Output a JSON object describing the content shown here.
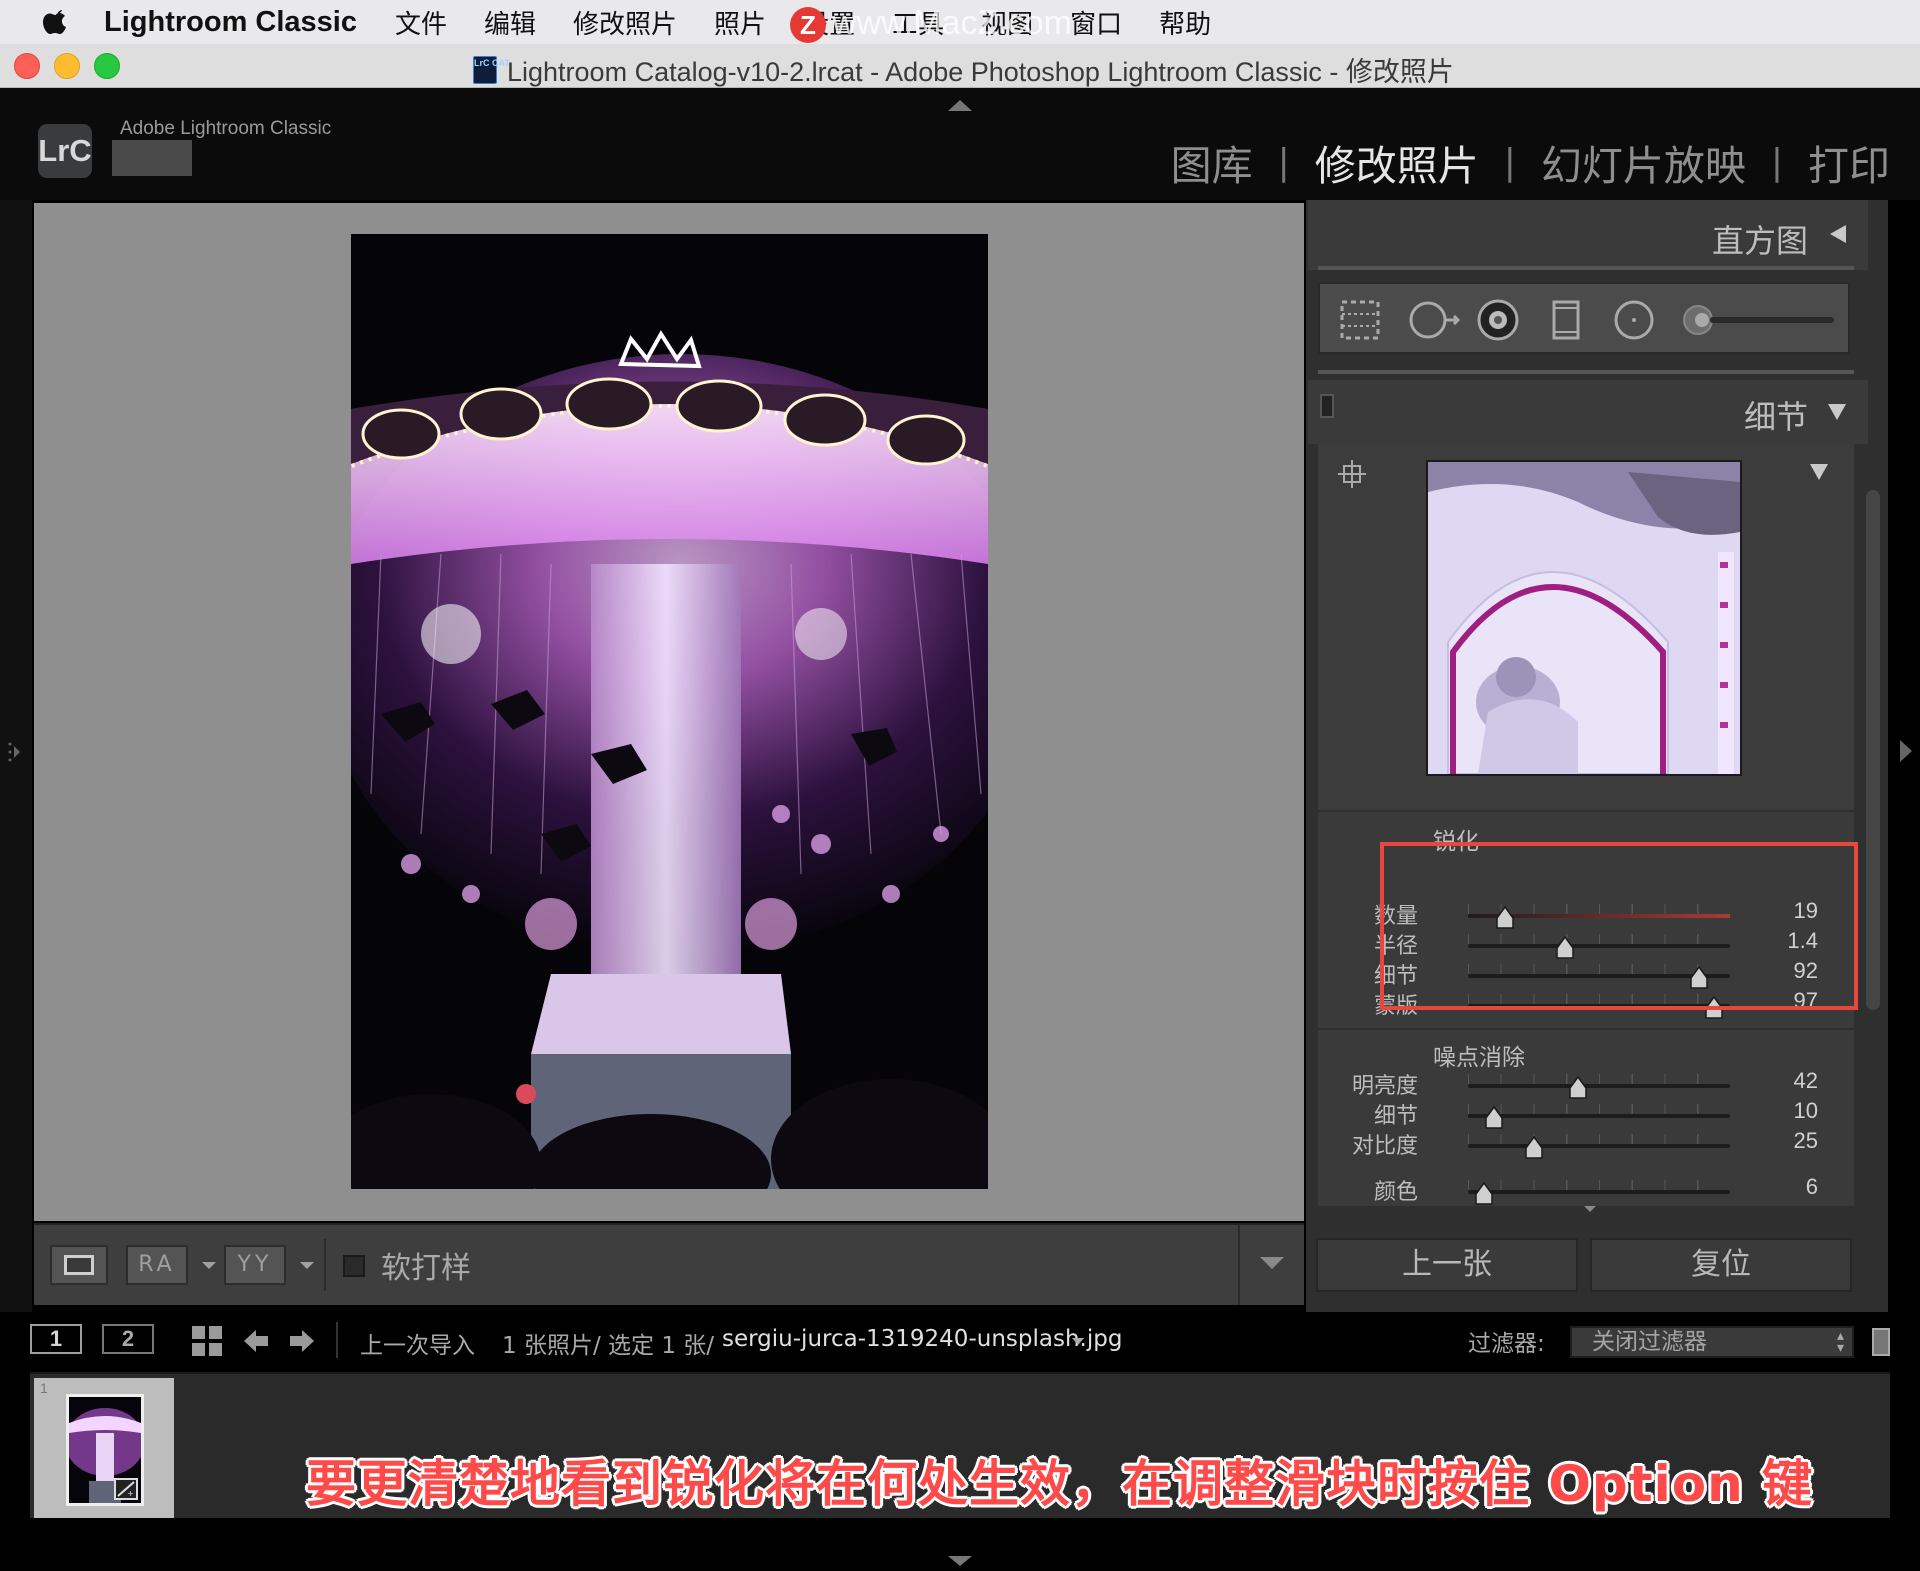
{
  "menubar": {
    "app_name": "Lightroom Classic",
    "items": [
      "文件",
      "编辑",
      "修改照片",
      "照片",
      "设置",
      "工具",
      "视图",
      "窗口",
      "帮助"
    ]
  },
  "watermark": {
    "logo_letter": "Z",
    "text": "www.MacZ.com"
  },
  "window": {
    "doc_icon_text": "LrC CAT",
    "title": "Lightroom Catalog-v10-2.lrcat - Adobe Photoshop Lightroom Classic - 修改照片"
  },
  "topbar": {
    "logo": "LrC",
    "brand": "Adobe Lightroom Classic",
    "modules": [
      {
        "label": "图库",
        "active": false
      },
      {
        "label": "修改照片",
        "active": true
      },
      {
        "label": "幻灯片放映",
        "active": false
      },
      {
        "label": "打印",
        "active": false
      }
    ],
    "separator": "|"
  },
  "toolbar": {
    "view_mode_1": "RA",
    "view_mode_2": "YY",
    "soft_proof_label": "软打样",
    "soft_proof_checked": false
  },
  "right_panel": {
    "histogram_title": "直方图",
    "detail_title": "细节",
    "sharpening": {
      "title": "锐化",
      "sliders": [
        {
          "label": "数量",
          "value": "19",
          "fraction": 0.14
        },
        {
          "label": "半径",
          "value": "1.4",
          "fraction": 0.37
        },
        {
          "label": "细节",
          "value": "92",
          "fraction": 0.88
        },
        {
          "label": "蒙版",
          "value": "97",
          "fraction": 0.94
        }
      ]
    },
    "noise_reduction": {
      "title": "噪点消除",
      "sliders": [
        {
          "label": "明亮度",
          "value": "42",
          "fraction": 0.42
        },
        {
          "label": "细节",
          "value": "10",
          "fraction": 0.1
        },
        {
          "label": "对比度",
          "value": "25",
          "fraction": 0.25
        }
      ],
      "color": {
        "label": "颜色",
        "value": "6",
        "fraction": 0.06
      }
    },
    "prev_button": "上一张",
    "reset_button": "复位",
    "highlight_color": "#e9473e"
  },
  "filmbar": {
    "page1": "1",
    "page2": "2",
    "source": "上一次导入",
    "count": "1 张照片/ 选定 1 张/",
    "filename": "sergiu-jurca-1319240-unsplash.jpg",
    "filter_label": "过滤器:",
    "filter_value": "关闭过滤器"
  },
  "filmstrip": {
    "thumb_index": "1"
  },
  "caption": "要更清楚地看到锐化将在何处生效，在调整滑块时按住 Option 键"
}
